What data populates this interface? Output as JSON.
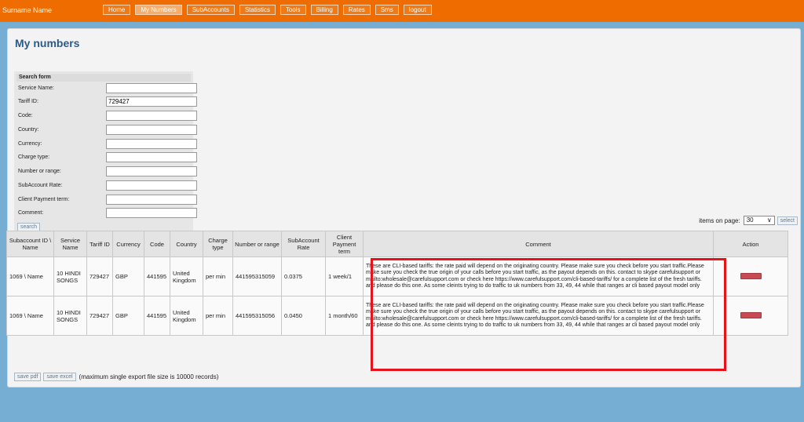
{
  "header": {
    "brand": "Surname Name",
    "nav": [
      "Home",
      "My Numbers",
      "SubAccounts",
      "Statistics",
      "Tools",
      "Billing",
      "Rates",
      "Sms",
      "logout"
    ],
    "active_index": 1
  },
  "page": {
    "title": "My numbers"
  },
  "search_form": {
    "title": "Search form",
    "fields": [
      {
        "label": "Service Name:",
        "value": ""
      },
      {
        "label": "Tariff ID:",
        "value": "729427"
      },
      {
        "label": "Code:",
        "value": ""
      },
      {
        "label": "Country:",
        "value": ""
      },
      {
        "label": "Currency:",
        "value": ""
      },
      {
        "label": "Charge type:",
        "value": ""
      },
      {
        "label": "Number or range:",
        "value": ""
      },
      {
        "label": "SubAccount Rate:",
        "value": ""
      },
      {
        "label": "Client Payment term:",
        "value": ""
      },
      {
        "label": "Comment:",
        "value": ""
      }
    ],
    "search_label": "search"
  },
  "pagination": {
    "items_label": "items on page:",
    "selected": "30",
    "select_label": "select"
  },
  "table": {
    "columns": [
      "Subaccount ID \\ Name",
      "Service Name",
      "Tariff ID",
      "Currency",
      "Code",
      "Country",
      "Charge type",
      "Number or range",
      "SubAccount Rate",
      "Client Payment term",
      "Comment",
      "Action"
    ],
    "rows": [
      [
        "1069 \\ Name",
        "10 HINDI SONGS",
        "729427",
        "GBP",
        "441595",
        "United Kingdom",
        "per min",
        "441595315059",
        "0.0375",
        "1 week/1",
        "These are CLI-based tariffs: the rate paid will depend on the originating country. Please make sure you check before you start traffic.Please make sure you check the true origin of your calls before you start traffic, as the payout depends on this. contact to skype carefulsupport or mailto:wholesale@carefulsupport.com or check here https://www.carefulsupport.com/cli-based-tariffs/ for a complete list of the fresh tariffs. and please do this one. As some cleints trying to do traffic to uk numbers from 33, 49, 44 while that ranges ar cli based payout model only"
      ],
      [
        "1069 \\ Name",
        "10 HINDI SONGS",
        "729427",
        "GBP",
        "441595",
        "United Kingdom",
        "per min",
        "441595315056",
        "0.0450",
        "1 month/60",
        "These are CLI-based tariffs: the rate paid will depend on the originating country. Please make sure you check before you start traffic.Please make sure you check the true origin of your calls before you start traffic, as the payout depends on this. contact to skype carefulsupport or mailto:wholesale@carefulsupport.com or check here https://www.carefulsupport.com/cli-based-tariffs/ for a complete list of the fresh tariffs. and please do this one. As some cleints trying to do traffic to uk numbers from 33, 49, 44 while that ranges ar cli based payout model only"
      ]
    ]
  },
  "export": {
    "pdf_label": "save pdf",
    "excel_label": "save excel",
    "note": "(maximum single export file size is 10000 records)"
  },
  "colors": {
    "topbar": "#ee6c00",
    "background": "#76aed3",
    "highlight": "#e8121a",
    "title": "#2b5a8a"
  }
}
